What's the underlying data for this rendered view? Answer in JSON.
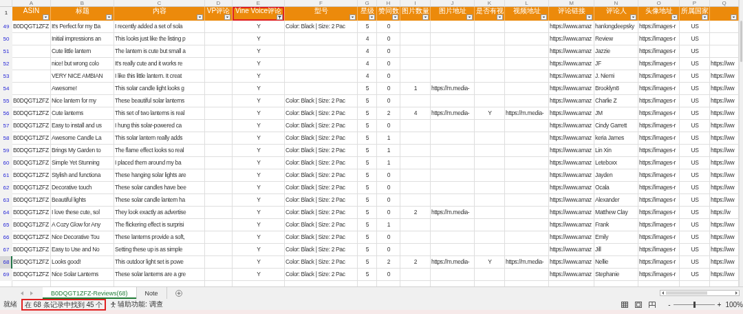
{
  "column_letters": [
    "A",
    "B",
    "C",
    "D",
    "E",
    "F",
    "G",
    "H",
    "I",
    "J",
    "K",
    "L",
    "M",
    "N",
    "O",
    "P",
    "Q"
  ],
  "header_row_number": "1",
  "columns": [
    {
      "header": "ASIN",
      "filtered": false,
      "highlighted": false
    },
    {
      "header": "标题",
      "filtered": false,
      "highlighted": false
    },
    {
      "header": "内容",
      "filtered": false,
      "highlighted": false
    },
    {
      "header": "VP评论",
      "filtered": false,
      "highlighted": false
    },
    {
      "header": "Vine Voice评论",
      "filtered": true,
      "highlighted": true
    },
    {
      "header": "型号",
      "filtered": false,
      "highlighted": false
    },
    {
      "header": "星级",
      "filtered": false,
      "highlighted": false
    },
    {
      "header": "赞同数",
      "filtered": false,
      "highlighted": false
    },
    {
      "header": "图片数量",
      "filtered": false,
      "highlighted": false
    },
    {
      "header": "图片地址",
      "filtered": false,
      "highlighted": false
    },
    {
      "header": "是否有视",
      "filtered": false,
      "highlighted": false
    },
    {
      "header": "视频地址",
      "filtered": false,
      "highlighted": false
    },
    {
      "header": "评论链接",
      "filtered": false,
      "highlighted": false
    },
    {
      "header": "评论人",
      "filtered": false,
      "highlighted": false
    },
    {
      "header": "头像地址",
      "filtered": false,
      "highlighted": false
    },
    {
      "header": "所属国家",
      "filtered": false,
      "highlighted": false
    },
    {
      "filtered": false,
      "highlighted": false
    }
  ],
  "rows": [
    {
      "number": "49",
      "selected": false,
      "cells": [
        "B0DQGT1ZFZ",
        "It's Perfect for my Ba",
        "I recently added a set of sola",
        null,
        "Y",
        "Color: Black | Size: 2 Pac",
        "5",
        "0",
        null,
        null,
        null,
        null,
        "https://www.amaz",
        "hanlongdeepsky",
        "https://images-r",
        "US",
        null
      ]
    },
    {
      "number": "50",
      "selected": false,
      "cells": [
        null,
        "Initial impressions an",
        "This looks just like the listing p",
        null,
        "Y",
        null,
        "4",
        "0",
        null,
        null,
        null,
        null,
        "https://www.amaz",
        "Review",
        "https://images-r",
        "US",
        null
      ]
    },
    {
      "number": "51",
      "selected": false,
      "cells": [
        null,
        "Cute little lantern",
        "The lantern is cute but small a",
        null,
        "Y",
        null,
        "4",
        "0",
        null,
        null,
        null,
        null,
        "https://www.amaz",
        "Jazzie",
        "https://images-r",
        "US",
        null
      ]
    },
    {
      "number": "52",
      "selected": false,
      "cells": [
        null,
        "nice! but wrong colo",
        "It's really cute and it works re",
        null,
        "Y",
        null,
        "4",
        "0",
        null,
        null,
        null,
        null,
        "https://www.amaz",
        "JF",
        "https://images-r",
        "US",
        "https://ww"
      ]
    },
    {
      "number": "53",
      "selected": false,
      "cells": [
        null,
        "VERY NICE AMBIAN",
        "I like this little lantern. It creat",
        null,
        "Y",
        null,
        "4",
        "0",
        null,
        null,
        null,
        null,
        "https://www.amaz",
        "J. Niemi",
        "https://images-r",
        "US",
        "https://ww"
      ]
    },
    {
      "number": "54",
      "selected": false,
      "cells": [
        null,
        "Awesome!",
        "This solar candle light looks g",
        null,
        "Y",
        null,
        "5",
        "0",
        "1",
        "https://m.media-",
        null,
        null,
        "https://www.amaz",
        "Brooklyn8",
        "https://images-r",
        "US",
        "https://ww"
      ]
    },
    {
      "number": "55",
      "selected": false,
      "cells": [
        "B0DQGT1ZFZ",
        "Nice lantern for my",
        "These beautiful solar lanterns",
        null,
        "Y",
        "Color: Black | Size: 2 Pac",
        "5",
        "0",
        null,
        null,
        null,
        null,
        "https://www.amaz",
        "Charlie Z",
        "https://images-r",
        "US",
        "https://ww"
      ]
    },
    {
      "number": "56",
      "selected": false,
      "cells": [
        "B0DQGT1ZFZ",
        "Cute lanterns",
        "This set of two lanterns is real",
        null,
        "Y",
        "Color: Black | Size: 2 Pac",
        "5",
        "2",
        "4",
        "https://m.media-",
        "Y",
        "https://m.media-",
        "https://www.amaz",
        "JM",
        "https://images-r",
        "US",
        "https://ww"
      ]
    },
    {
      "number": "57",
      "selected": false,
      "cells": [
        "B0DQGT1ZFZ",
        "Easy to install and us",
        "I hung this solar-powered ca",
        null,
        "Y",
        "Color: Black | Size: 2 Pac",
        "5",
        "0",
        null,
        null,
        null,
        null,
        "https://www.amaz",
        "Cindy Garrett",
        "https://images-r",
        "US",
        "https://ww"
      ]
    },
    {
      "number": "58",
      "selected": false,
      "cells": [
        "B0DQGT1ZFZ",
        "Awesome Candle La",
        "This solar lantern really adds",
        null,
        "Y",
        "Color: Black | Size: 2 Pac",
        "5",
        "1",
        null,
        null,
        null,
        null,
        "https://www.amaz",
        "keria James",
        "https://images-r",
        "US",
        "https://ww"
      ]
    },
    {
      "number": "59",
      "selected": false,
      "cells": [
        "B0DQGT1ZFZ",
        "Brings My Garden to",
        "The flame effect looks so real",
        null,
        "Y",
        "Color: Black | Size: 2 Pac",
        "5",
        "1",
        null,
        null,
        null,
        null,
        "https://www.amaz",
        "Lin Xin",
        "https://images-r",
        "US",
        "https://ww"
      ]
    },
    {
      "number": "60",
      "selected": false,
      "cells": [
        "B0DQGT1ZFZ",
        "Simple Yet Stunning",
        "I placed them around my ba",
        null,
        "Y",
        "Color: Black | Size: 2 Pac",
        "5",
        "1",
        null,
        null,
        null,
        null,
        "https://www.amaz",
        "Leteboxx",
        "https://images-r",
        "US",
        "https://ww"
      ]
    },
    {
      "number": "61",
      "selected": false,
      "cells": [
        "B0DQGT1ZFZ",
        "Stylish and functiona",
        "These hanging solar lights are",
        null,
        "Y",
        "Color: Black | Size: 2 Pac",
        "5",
        "0",
        null,
        null,
        null,
        null,
        "https://www.amaz",
        "Jayden",
        "https://images-r",
        "US",
        "https://ww"
      ]
    },
    {
      "number": "62",
      "selected": false,
      "cells": [
        "B0DQGT1ZFZ",
        "Decorative touch",
        "These solar candles have bee",
        null,
        "Y",
        "Color: Black | Size: 2 Pac",
        "5",
        "0",
        null,
        null,
        null,
        null,
        "https://www.amaz",
        "Ocala",
        "https://images-r",
        "US",
        "https://ww"
      ]
    },
    {
      "number": "63",
      "selected": false,
      "cells": [
        "B0DQGT1ZFZ",
        "Beautiful lights",
        "These solar candle lantern ha",
        null,
        "Y",
        "Color: Black | Size: 2 Pac",
        "5",
        "0",
        null,
        null,
        null,
        null,
        "https://www.amaz",
        "Alexander",
        "https://images-r",
        "US",
        "https://ww"
      ]
    },
    {
      "number": "64",
      "selected": false,
      "cells": [
        "B0DQGT1ZFZ",
        "I love these cute, sol",
        "They look exactly as advertise",
        null,
        "Y",
        "Color: Black | Size: 2 Pac",
        "5",
        "0",
        "2",
        "https://m.media-",
        null,
        null,
        "https://www.amaz",
        "Matthew Clay",
        "https://images-r",
        "US",
        "https://w"
      ]
    },
    {
      "number": "65",
      "selected": false,
      "cells": [
        "B0DQGT1ZFZ",
        "A Cozy Glow for Any",
        "The flickering effect is surprisi",
        null,
        "Y",
        "Color: Black | Size: 2 Pac",
        "5",
        "1",
        null,
        null,
        null,
        null,
        "https://www.amaz",
        "Frank",
        "https://images-r",
        "US",
        "https://ww"
      ]
    },
    {
      "number": "66",
      "selected": false,
      "cells": [
        "B0DQGT1ZFZ",
        "Nice Decorative Tou",
        "These lanterns provide a soft,",
        null,
        "Y",
        "Color: Black | Size: 2 Pac",
        "5",
        "0",
        null,
        null,
        null,
        null,
        "https://www.amaz",
        "Emily",
        "https://images-r",
        "US",
        "https://ww"
      ]
    },
    {
      "number": "67",
      "selected": false,
      "cells": [
        "B0DQGT1ZFZ",
        "Easy to Use and No",
        "Setting these up is as simple",
        null,
        "Y",
        "Color: Black | Size: 2 Pac",
        "5",
        "0",
        null,
        null,
        null,
        null,
        "https://www.amaz",
        "Jill",
        "https://images-r",
        "US",
        "https://ww"
      ]
    },
    {
      "number": "68",
      "selected": true,
      "cells": [
        "B0DQGT1ZFZ",
        "Looks good!",
        "This outdoor light set is powe",
        null,
        "Y",
        "Color: Black | Size: 2 Pac",
        "5",
        "2",
        "2",
        "https://m.media-",
        "Y",
        "https://m.media-",
        "https://www.amaz",
        "Nellie",
        "https://images-r",
        "US",
        "https://ww"
      ]
    },
    {
      "number": "69",
      "selected": false,
      "cells": [
        "B0DQGT1ZFZ",
        "Nice Solar Lanterns",
        "These solar lanterns are a gre",
        null,
        "Y",
        "Color: Black | Size: 2 Pac",
        "5",
        "0",
        null,
        null,
        null,
        null,
        "https://www.amaz",
        "Stephanie",
        "https://images-r",
        "US",
        "https://ww"
      ]
    }
  ],
  "sheet_tabs": [
    {
      "label": "B0DQGT1ZFZ-Reviews(68)",
      "selected": true
    },
    {
      "label": "Note",
      "selected": false
    }
  ],
  "status_bar": {
    "ready": "就绪",
    "filter_result": {
      "text": "在 68 条记录中找到 45 个",
      "highlighted": true
    },
    "accessibility": "辅助功能: 调查",
    "zoom_out": "-",
    "zoom_in": "+",
    "zoom": {
      "level": 0.5
    },
    "zoom_label": "100%"
  }
}
